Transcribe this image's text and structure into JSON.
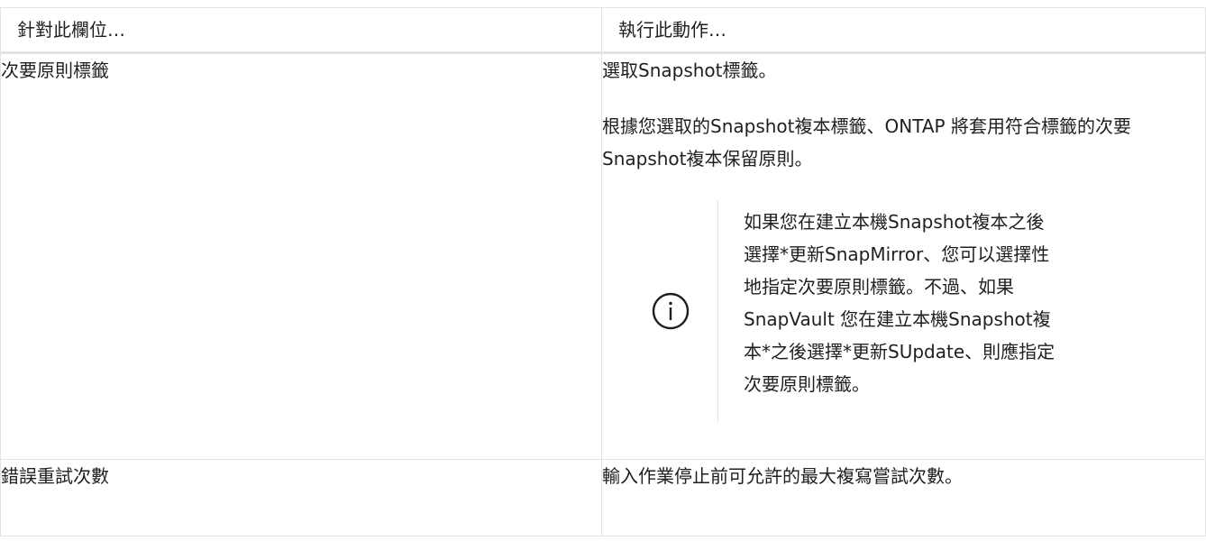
{
  "table": {
    "headers": {
      "field": "針對此欄位…",
      "action": "執行此動作…"
    },
    "rows": [
      {
        "field": "次要原則標籤",
        "action_line1": "選取Snapshot標籤。",
        "action_line2": "根據您選取的Snapshot複本標籤、ONTAP 將套用符合標籤的次要Snapshot複本保留原則。",
        "note": "如果您在建立本機Snapshot複本之後選擇*更新SnapMirror、您可以選擇性地指定次要原則標籤。不過、如果SnapVault 您在建立本機Snapshot複本*之後選擇*更新SUpdate、則應指定次要原則標籤。",
        "note_icon": "info-icon"
      },
      {
        "field": "錯誤重試次數",
        "action_line1": "輸入作業停止前可允許的最大複寫嘗試次數。"
      }
    ]
  },
  "colors": {
    "border": "#dfe3e8",
    "text": "#1f1f1f",
    "icon": "#1f1f1f"
  }
}
